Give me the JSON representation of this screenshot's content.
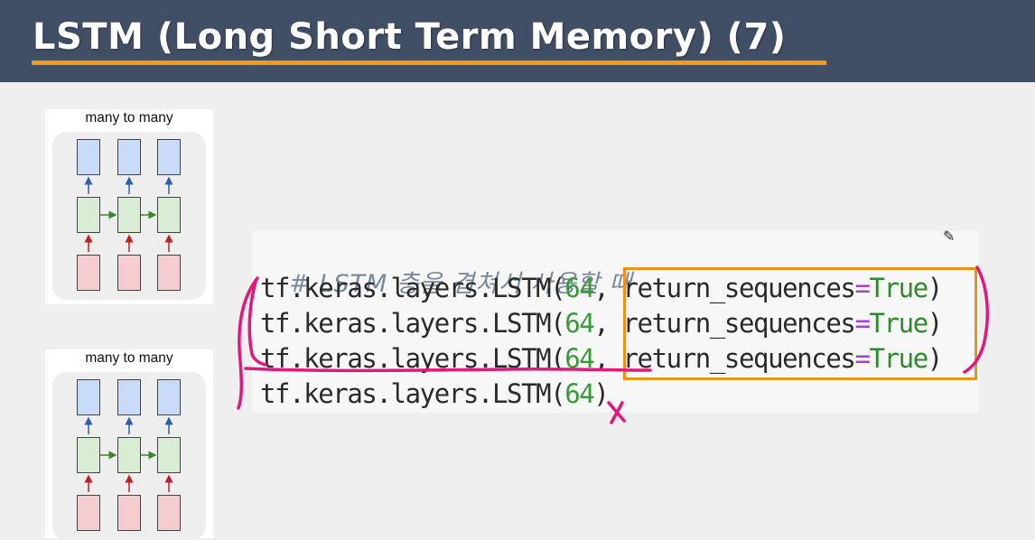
{
  "header": {
    "title": "LSTM (Long Short Term Memory) (7)"
  },
  "diagrams": [
    {
      "label": "many to many"
    },
    {
      "label": "many to many"
    }
  ],
  "code": {
    "comment": "# LSTM 층을 겹쳐서 사용할 때",
    "lines": [
      {
        "prefix": "tf.keras.layers.LSTM(",
        "num": "64",
        "sep": ", ",
        "param": "return_sequences",
        "eq": "=",
        "kw": "True",
        "close": ")"
      },
      {
        "prefix": "tf.keras.layers.LSTM(",
        "num": "64",
        "sep": ", ",
        "param": "return_sequences",
        "eq": "=",
        "kw": "True",
        "close": ")"
      },
      {
        "prefix": "tf.keras.layers.LSTM(",
        "num": "64",
        "sep": ", ",
        "param": "return_sequences",
        "eq": "=",
        "kw": "True",
        "close": ")"
      },
      {
        "prefix": "tf.keras.layers.LSTM(",
        "num": "64",
        "close": ")"
      }
    ]
  },
  "annotation": {
    "mark": "X"
  },
  "colors": {
    "header_bg": "#414f66",
    "underline": "#f39a1e",
    "highlight_box": "#e8941a",
    "pen": "#e0197d"
  },
  "icons": {
    "cursor": "pencil-cursor-icon"
  }
}
